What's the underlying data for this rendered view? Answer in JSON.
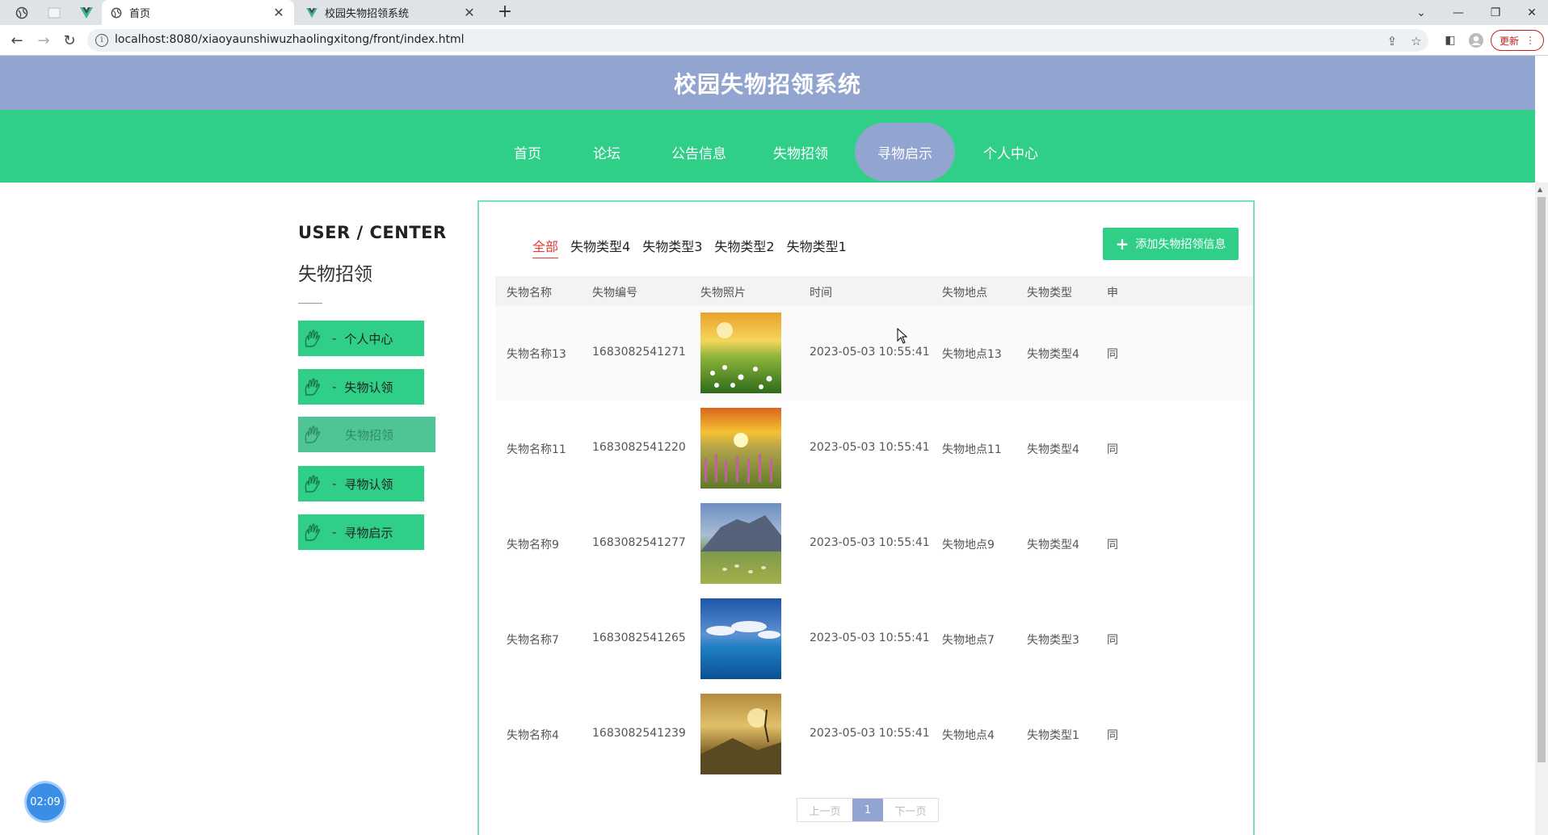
{
  "browser": {
    "tabs": [
      {
        "title": "首页",
        "active": true
      },
      {
        "title": "校园失物招领系统",
        "active": false
      }
    ],
    "url": "localhost:8080/xiaoyaunshiwuzhaolingxitong/front/index.html",
    "update_label": "更新"
  },
  "site": {
    "title": "校园失物招领系统",
    "nav": [
      "首页",
      "论坛",
      "公告信息",
      "失物招领",
      "寻物启示",
      "个人中心"
    ],
    "nav_active": "寻物启示"
  },
  "sidebar": {
    "heading": "USER / CENTER",
    "subtitle": "失物招领",
    "items": [
      {
        "label": "个人中心",
        "active": false
      },
      {
        "label": "失物认领",
        "active": false
      },
      {
        "label": "失物招领",
        "active": true
      },
      {
        "label": "寻物认领",
        "active": false
      },
      {
        "label": "寻物启示",
        "active": false
      }
    ]
  },
  "main": {
    "filters": [
      "全部",
      "失物类型4",
      "失物类型3",
      "失物类型2",
      "失物类型1"
    ],
    "filter_active": "全部",
    "add_button": "添加失物招领信息",
    "columns": [
      "失物名称",
      "失物编号",
      "失物照片",
      "时间",
      "失物地点",
      "失物类型",
      "申"
    ],
    "rows": [
      {
        "name": "失物名称13",
        "code": "1683082541271",
        "photo": "meadow-flowers",
        "time": "2023-05-03 10:55:41",
        "place": "失物地点13",
        "type": "失物类型4",
        "extra": "同"
      },
      {
        "name": "失物名称11",
        "code": "1683082541220",
        "photo": "sunset-field",
        "time": "2023-05-03 10:55:41",
        "place": "失物地点11",
        "type": "失物类型4",
        "extra": "同"
      },
      {
        "name": "失物名称9",
        "code": "1683082541277",
        "photo": "mountain-pasture",
        "time": "2023-05-03 10:55:41",
        "place": "失物地点9",
        "type": "失物类型4",
        "extra": "同"
      },
      {
        "name": "失物名称7",
        "code": "1683082541265",
        "photo": "sky-sea",
        "time": "2023-05-03 10:55:41",
        "place": "失物地点7",
        "type": "失物类型3",
        "extra": "同"
      },
      {
        "name": "失物名称4",
        "code": "1683082541239",
        "photo": "golden-valley",
        "time": "2023-05-03 10:55:41",
        "place": "失物地点4",
        "type": "失物类型1",
        "extra": "同"
      }
    ],
    "pager": {
      "prev": "上一页",
      "current": "1",
      "next": "下一页"
    }
  },
  "timer": "02:09",
  "colors": {
    "accent_green": "#2fcf88",
    "header_blue": "#92a5d0",
    "active_filter": "#e23c39"
  }
}
